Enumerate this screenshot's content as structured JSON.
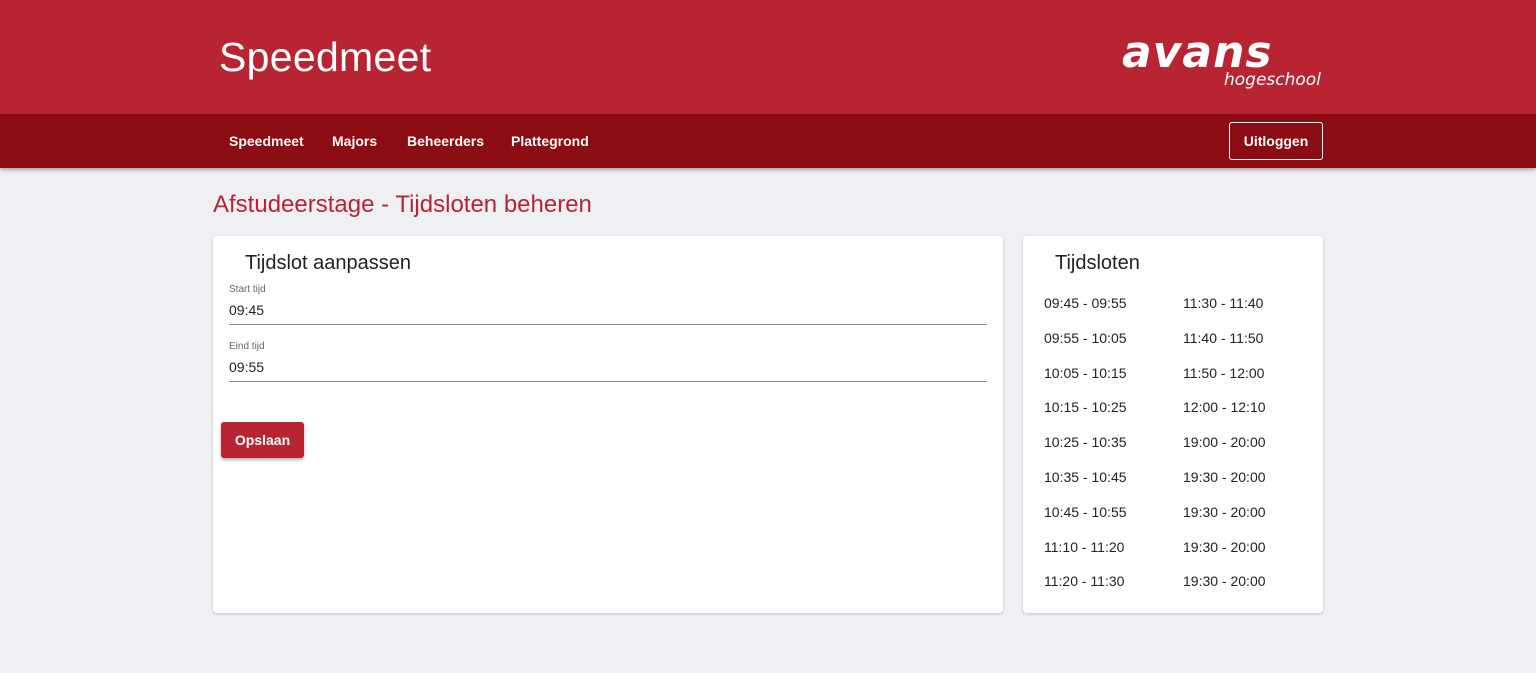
{
  "header": {
    "title": "Speedmeet",
    "logo_main": "avans",
    "logo_sub": "hogeschool"
  },
  "nav": {
    "items": [
      {
        "label": "Speedmeet"
      },
      {
        "label": "Majors"
      },
      {
        "label": "Beheerders"
      },
      {
        "label": "Plattegrond"
      }
    ],
    "logout_label": "Uitloggen"
  },
  "page": {
    "title": "Afstudeerstage - Tijdsloten beheren"
  },
  "edit_card": {
    "title": "Tijdslot aanpassen",
    "start_label": "Start tijd",
    "start_value": "09:45",
    "end_label": "Eind tijd",
    "end_value": "09:55",
    "save_label": "Opslaan"
  },
  "slots_card": {
    "title": "Tijdsloten",
    "column_1": [
      "09:45 - 09:55",
      "09:55 - 10:05",
      "10:05 - 10:15",
      "10:15 - 10:25",
      "10:25 - 10:35",
      "10:35 - 10:45",
      "10:45 - 10:55",
      "11:10 - 11:20",
      "11:20 - 11:30"
    ],
    "column_2": [
      "11:30 - 11:40",
      "11:40 - 11:50",
      "11:50 - 12:00",
      "12:00 - 12:10",
      "19:00 - 20:00",
      "19:30 - 20:00",
      "19:30 - 20:00",
      "19:30 - 20:00",
      "19:30 - 20:00"
    ]
  },
  "colors": {
    "brand_red": "#b92433",
    "nav_dark_red": "#8b0c12",
    "background": "#eff0f4"
  }
}
